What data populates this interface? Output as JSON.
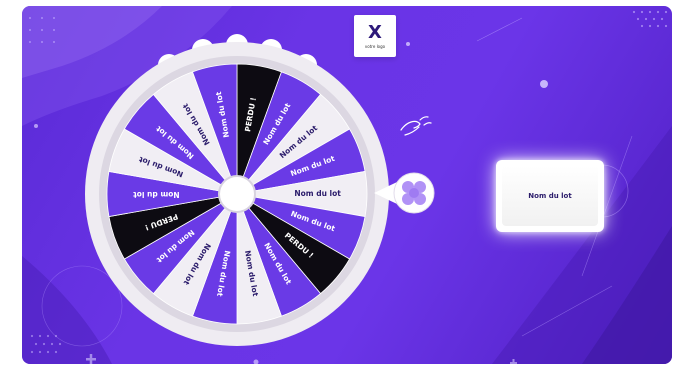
{
  "logo": {
    "mark": "X",
    "subtitle": "votre logo"
  },
  "wheel": {
    "segments": [
      {
        "label": "PERDU !",
        "color": "#0d0b12",
        "text_color": "#ffffff"
      },
      {
        "label": "Nom du lot",
        "color": "#6a3ae6",
        "text_color": "#ffffff"
      },
      {
        "label": "Nom du lot",
        "color": "#f1eef4",
        "text_color": "#2b1c6b"
      },
      {
        "label": "Nom du lot",
        "color": "#6a3ae6",
        "text_color": "#ffffff"
      },
      {
        "label": "Nom du lot",
        "color": "#f1eef4",
        "text_color": "#2b1c6b"
      },
      {
        "label": "Nom du lot",
        "color": "#6a3ae6",
        "text_color": "#ffffff"
      },
      {
        "label": "PERDU !",
        "color": "#0d0b12",
        "text_color": "#ffffff"
      },
      {
        "label": "Nom du lot",
        "color": "#6a3ae6",
        "text_color": "#ffffff"
      },
      {
        "label": "Nom du lot",
        "color": "#f1eef4",
        "text_color": "#2b1c6b"
      },
      {
        "label": "Nom du lot",
        "color": "#6a3ae6",
        "text_color": "#ffffff"
      },
      {
        "label": "Nom du lot",
        "color": "#f1eef4",
        "text_color": "#2b1c6b"
      },
      {
        "label": "Nom du lot",
        "color": "#6a3ae6",
        "text_color": "#ffffff"
      },
      {
        "label": "PERDU !",
        "color": "#0d0b12",
        "text_color": "#ffffff"
      },
      {
        "label": "Nom du lot",
        "color": "#6a3ae6",
        "text_color": "#ffffff"
      },
      {
        "label": "Nom du lot",
        "color": "#f1eef4",
        "text_color": "#2b1c6b"
      },
      {
        "label": "Nom du lot",
        "color": "#6a3ae6",
        "text_color": "#ffffff"
      },
      {
        "label": "Nom du lot",
        "color": "#f1eef4",
        "text_color": "#2b1c6b"
      },
      {
        "label": "Nom du lot",
        "color": "#6a3ae6",
        "text_color": "#ffffff"
      }
    ],
    "pointer_icon": "clover-icon",
    "spin_hint_icon": "hand-swipe-icon"
  },
  "prize": {
    "label": "Nom du lot"
  },
  "colors": {
    "background": "#6a34e6",
    "rim": "#f2f0f4",
    "light": "#ffffff"
  }
}
